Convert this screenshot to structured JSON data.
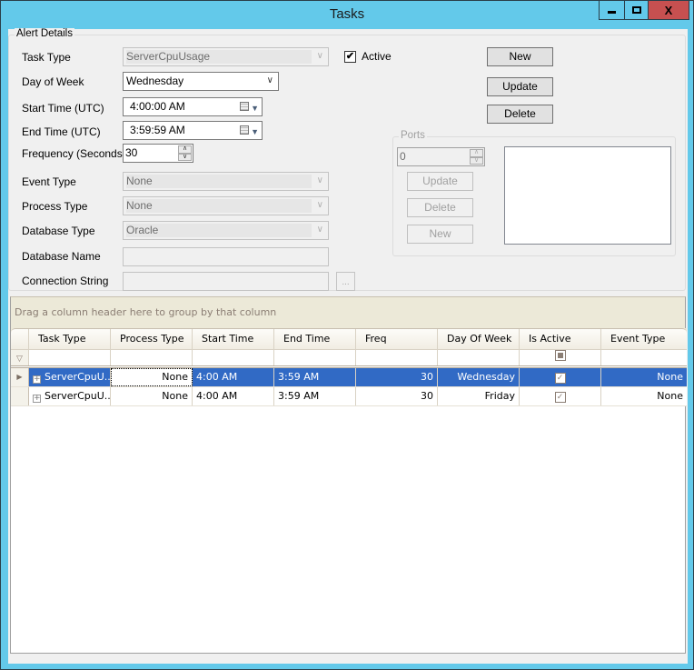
{
  "window": {
    "title": "Tasks",
    "minimize_glyph": "minimize",
    "maximize_glyph": "maximize",
    "close_label": "X"
  },
  "alert_details": {
    "group_label": "Alert Details",
    "task_type": {
      "label": "Task Type",
      "value": "ServerCpuUsage",
      "enabled": false
    },
    "day_of_week": {
      "label": "Day of Week",
      "value": "Wednesday",
      "enabled": true
    },
    "start_time": {
      "label": "Start Time (UTC)",
      "value": "4:00:00 AM"
    },
    "end_time": {
      "label": "End Time (UTC)",
      "value": "3:59:59 AM"
    },
    "frequency": {
      "label": "Frequency (Seconds)",
      "value": "30"
    },
    "event_type": {
      "label": "Event Type",
      "value": "None",
      "enabled": false
    },
    "process_type": {
      "label": "Process Type",
      "value": "None",
      "enabled": false
    },
    "database_type": {
      "label": "Database Type",
      "value": "Oracle",
      "enabled": false
    },
    "database_name": {
      "label": "Database Name",
      "value": ""
    },
    "connection_string": {
      "label": "Connection String",
      "value": "",
      "browse_label": "..."
    },
    "active": {
      "label": "Active",
      "checked": true,
      "check_glyph": "✔"
    },
    "buttons": {
      "new": "New",
      "update": "Update",
      "delete": "Delete"
    }
  },
  "ports": {
    "group_label": "Ports",
    "port_value": "0",
    "buttons": {
      "update": "Update",
      "delete": "Delete",
      "new": "New"
    }
  },
  "grid": {
    "group_panel_hint": "Drag a column header here to group by that column",
    "columns": [
      "Task Type",
      "Process Type",
      "Start Time",
      "End Time",
      "Freq",
      "Day Of Week",
      "Is Active",
      "Event Type"
    ],
    "rows": [
      {
        "task_type": "ServerCpuU...",
        "process_type": "None",
        "start_time": "4:00 AM",
        "end_time": "3:59 AM",
        "freq": "30",
        "day_of_week": "Wednesday",
        "is_active": true,
        "event_type": "None",
        "selected": true
      },
      {
        "task_type": "ServerCpuU...",
        "process_type": "None",
        "start_time": "4:00 AM",
        "end_time": "3:59 AM",
        "freq": "30",
        "day_of_week": "Friday",
        "is_active": true,
        "event_type": "None",
        "selected": false
      }
    ],
    "colors": {
      "selection": "#316ac5",
      "group_panel": "#ece9d8"
    }
  }
}
